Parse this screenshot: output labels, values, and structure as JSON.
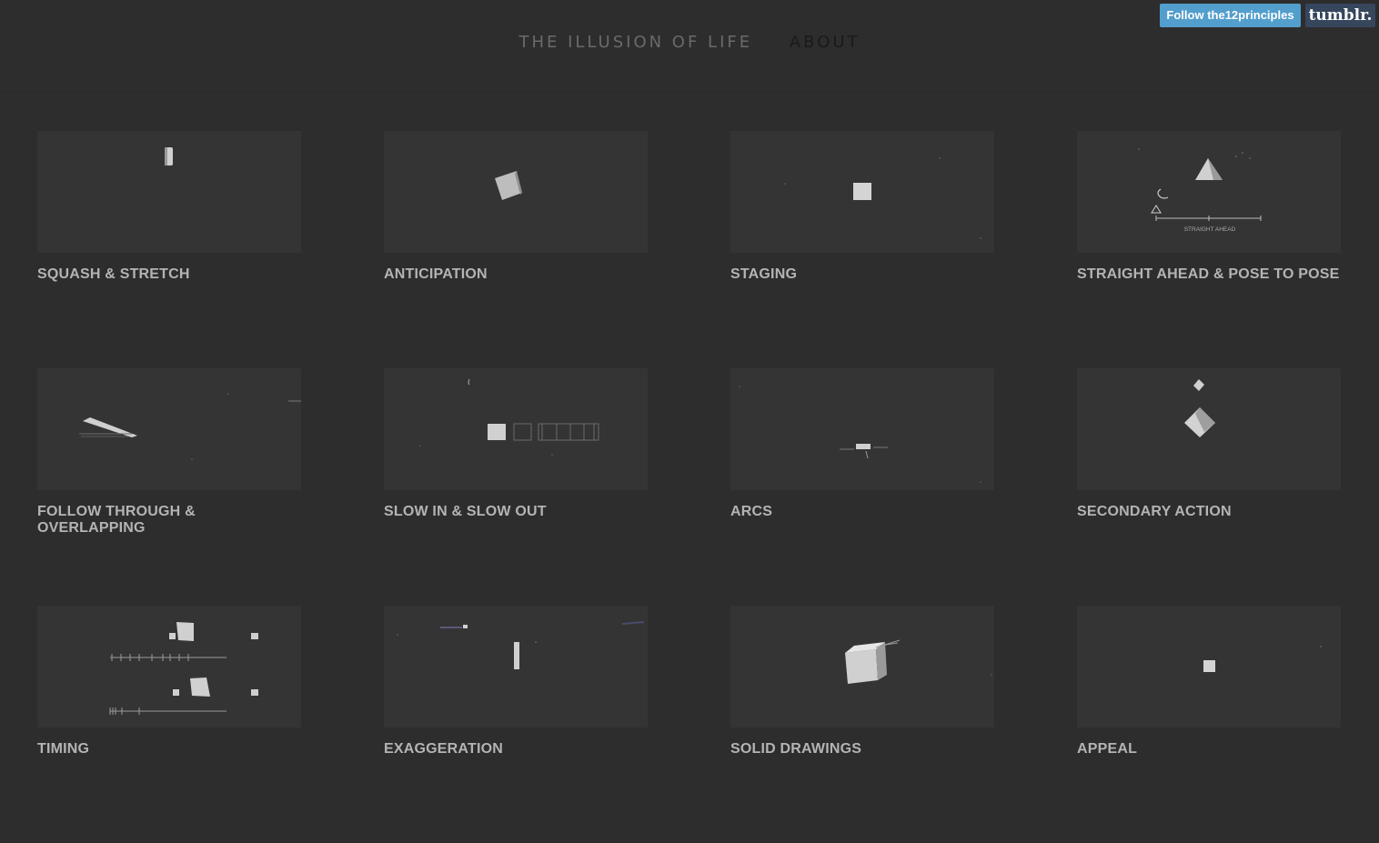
{
  "header": {
    "site_title": "THE ILLUSION OF LIFE",
    "about": "ABOUT",
    "follow_button": "Follow the12principles",
    "tumblr_button": "tumblr."
  },
  "tiles": [
    {
      "title": "SQUASH & STRETCH"
    },
    {
      "title": "ANTICIPATION"
    },
    {
      "title": "STAGING"
    },
    {
      "title": "STRAIGHT AHEAD & POSE TO POSE",
      "thumb_text": "STRAIGHT AHEAD"
    },
    {
      "title": "FOLLOW THROUGH & OVERLAPPING"
    },
    {
      "title": "SLOW IN & SLOW OUT"
    },
    {
      "title": "ARCS"
    },
    {
      "title": "SECONDARY ACTION"
    },
    {
      "title": "TIMING"
    },
    {
      "title": "EXAGGERATION"
    },
    {
      "title": "SOLID DRAWINGS"
    },
    {
      "title": "APPEAL"
    }
  ]
}
